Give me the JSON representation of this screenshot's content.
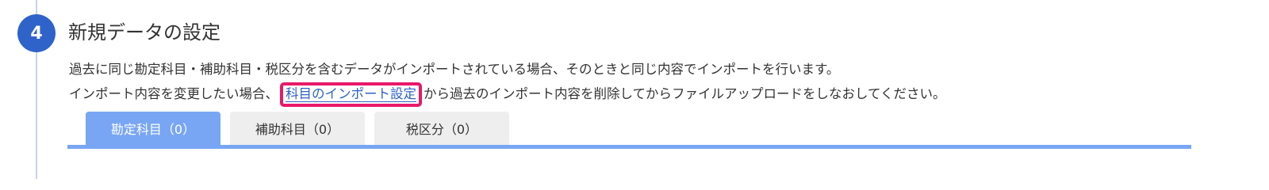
{
  "step": {
    "number": "4",
    "title": "新規データの設定"
  },
  "description": {
    "line1": "過去に同じ勘定科目・補助科目・税区分を含むデータがインポートされている場合、そのときと同じ内容でインポートを行います。",
    "line2_before": "インポート内容を変更したい場合、",
    "line2_link": "科目のインポート設定",
    "line2_after": "から過去のインポート内容を削除してからファイルアップロードをしなおしてください。"
  },
  "tabs": [
    {
      "label": "勘定科目（0）",
      "active": true
    },
    {
      "label": "補助科目（0）",
      "active": false
    },
    {
      "label": "税区分（0）",
      "active": false
    }
  ],
  "colors": {
    "accent": "#2f63c9",
    "active_tab": "#78a6f4",
    "highlight": "#e8196a",
    "inactive_tab": "#eeeeee"
  }
}
